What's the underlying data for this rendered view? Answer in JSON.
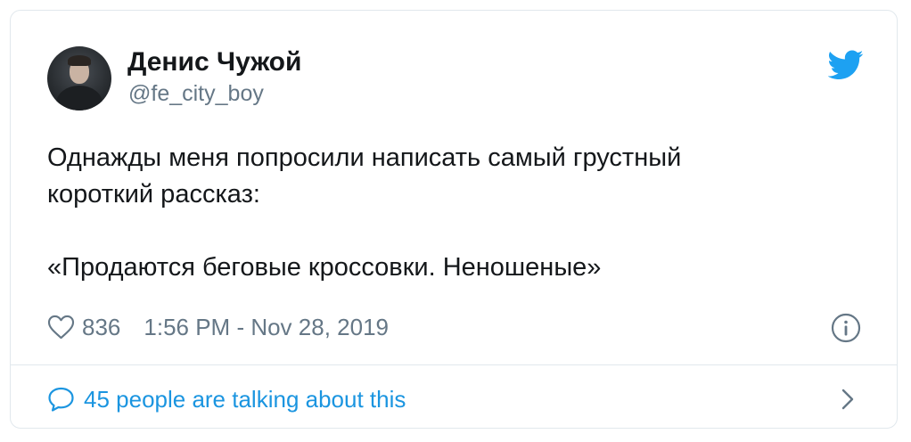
{
  "author": {
    "name": "Денис Чужой",
    "handle": "@fe_city_boy"
  },
  "tweet": {
    "lines": [
      "Однажды меня попросили написать самый грустный",
      "короткий рассказ:"
    ],
    "quote": "«Продаются беговые кроссовки. Неношеные»"
  },
  "meta": {
    "likes": "836",
    "timestamp": "1:56 PM - Nov 28, 2019"
  },
  "footer": {
    "conversation": "45 people are talking about this"
  },
  "icons": {
    "brand": "twitter-bird-icon",
    "like": "heart-icon",
    "info": "info-icon",
    "conversation": "speech-bubble-icon",
    "more": "chevron-right-icon"
  },
  "colors": {
    "brand_blue": "#1da1f2",
    "link_blue": "#1b95e0",
    "muted_text": "#657786",
    "main_text": "#14171a",
    "border": "#e1e8ed"
  }
}
